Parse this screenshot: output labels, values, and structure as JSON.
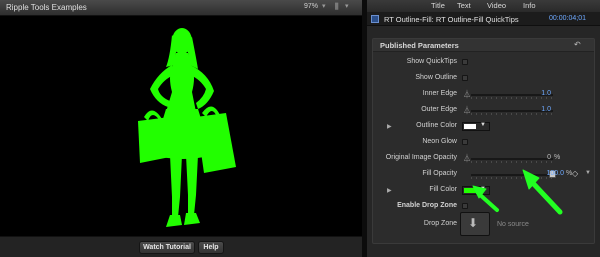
{
  "viewer": {
    "title": "Ripple Tools Examples",
    "zoom": "97%",
    "zoom_chevron_icon": "chevron-down-icon",
    "view_options_icon": "switch-icon",
    "footer": {
      "watch_label": "Watch Tutorial",
      "help_label": "Help"
    },
    "colors": {
      "silhouette": "#22ff00",
      "background": "#000000"
    }
  },
  "inspector": {
    "tabs": [
      {
        "label": "Title"
      },
      {
        "label": "Text"
      },
      {
        "label": "Video"
      },
      {
        "label": "Info"
      }
    ],
    "effect_title": "RT Outline-Fill: RT Outline-Fill QuickTips",
    "timecode": "00:00:04;01",
    "published_title": "Published Parameters",
    "reset_icon": "reset-arrow-icon",
    "rows": {
      "show_quicktips": {
        "label": "Show QuickTips"
      },
      "show_outline": {
        "label": "Show Outline"
      },
      "inner_edge": {
        "label": "Inner Edge",
        "value": "1.0",
        "level": 1.0
      },
      "outer_edge": {
        "label": "Outer Edge",
        "value": "1.0",
        "level": 1.0
      },
      "outline_color": {
        "label": "Outline Color",
        "color": "#ffffff"
      },
      "neon_glow": {
        "label": "Neon Glow"
      },
      "orig_opacity": {
        "label": "Original Image Opacity",
        "value": "0",
        "unit": "%",
        "level": 0
      },
      "fill_opacity": {
        "label": "Fill Opacity",
        "value": "100.0",
        "unit": "%",
        "level": 1.0
      },
      "fill_color": {
        "label": "Fill Color",
        "color": "#22ff00"
      },
      "drop_enable": {
        "label": "Enable Drop Zone"
      },
      "drop_zone": {
        "label": "Drop Zone",
        "placeholder": "No source"
      }
    }
  },
  "annotations": {
    "arrow_color": "#22ff22"
  }
}
